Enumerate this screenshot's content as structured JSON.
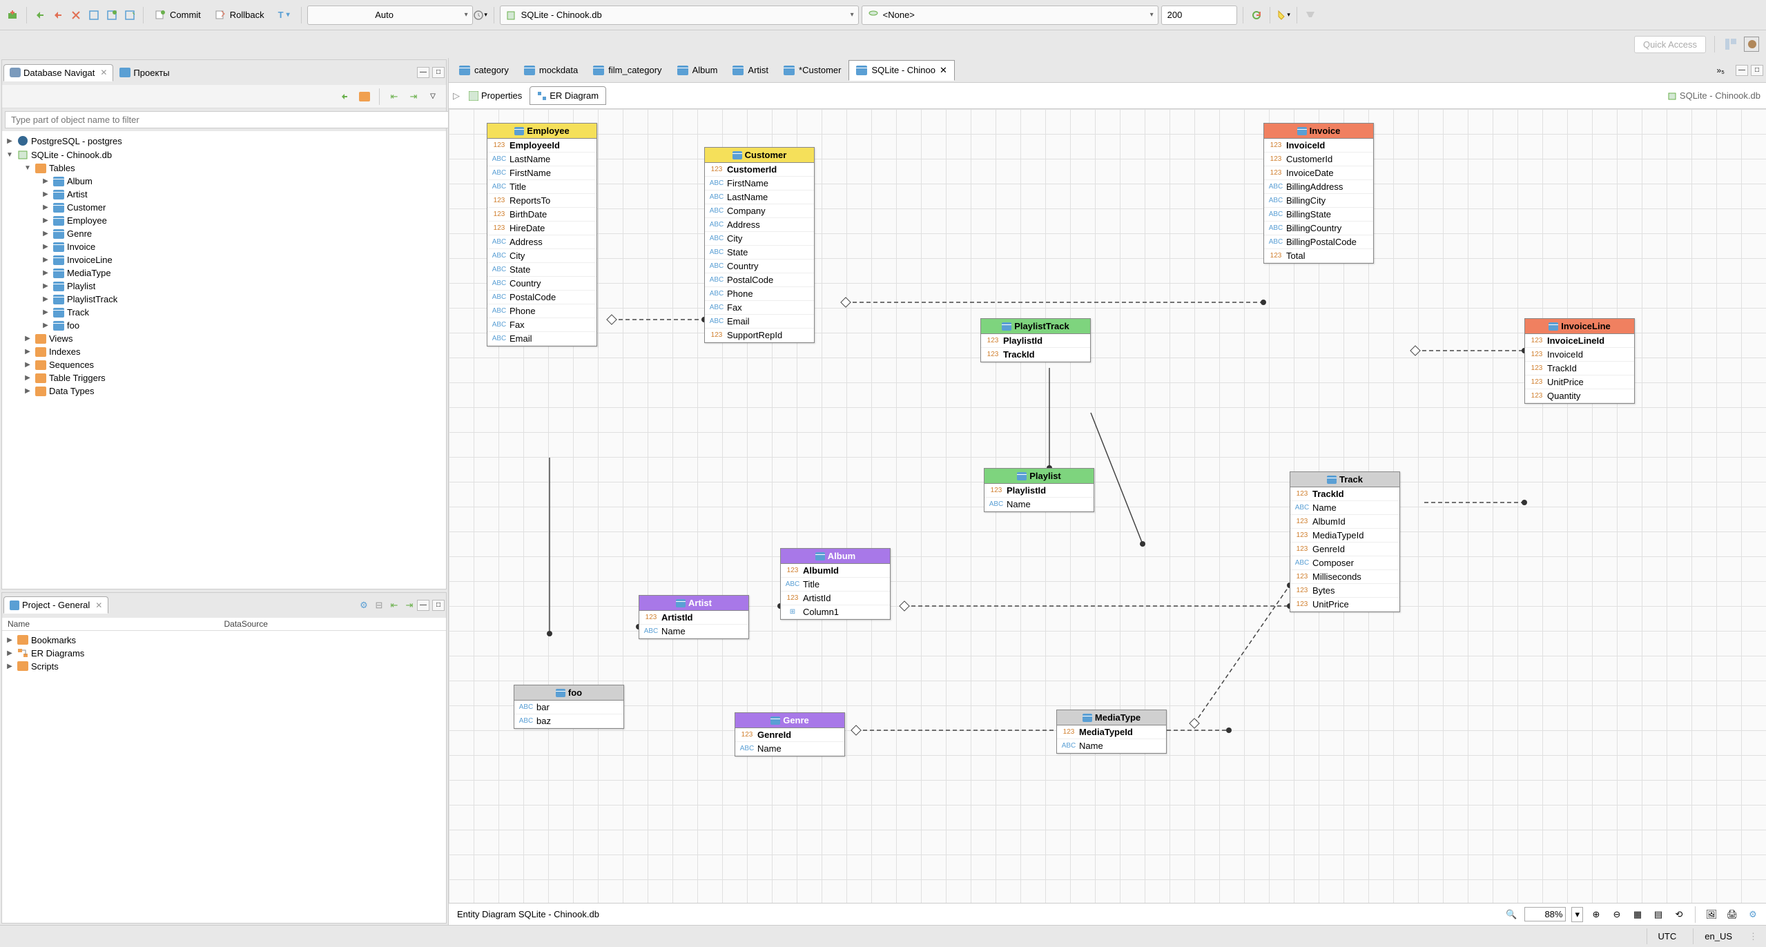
{
  "toolbar": {
    "commit": "Commit",
    "rollback": "Rollback",
    "tx_mode": "Auto",
    "datasource": "SQLite - Chinook.db",
    "schema": "<None>",
    "limit": "200",
    "quick_access": "Quick Access"
  },
  "nav_panel": {
    "title": "Database Navigat",
    "projects_tab": "Проекты",
    "filter_placeholder": "Type part of object name to filter",
    "connections": [
      {
        "name": "PostgreSQL - postgres",
        "expanded": false
      },
      {
        "name": "SQLite - Chinook.db",
        "expanded": true
      }
    ],
    "tables_label": "Tables",
    "tables": [
      "Album",
      "Artist",
      "Customer",
      "Employee",
      "Genre",
      "Invoice",
      "InvoiceLine",
      "MediaType",
      "Playlist",
      "PlaylistTrack",
      "Track",
      "foo"
    ],
    "folders": [
      "Views",
      "Indexes",
      "Sequences",
      "Table Triggers",
      "Data Types"
    ]
  },
  "project_panel": {
    "title": "Project - General",
    "col_name": "Name",
    "col_ds": "DataSource",
    "items": [
      "Bookmarks",
      "ER Diagrams",
      "Scripts"
    ]
  },
  "editor_tabs": [
    "category",
    "mockdata",
    "film_category",
    "Album",
    "Artist",
    "*Customer",
    "SQLite - Chinoo"
  ],
  "editor_active": 6,
  "editor_overflow": "»₅",
  "sub_tabs": {
    "properties": "Properties",
    "diagram": "ER Diagram"
  },
  "breadcrumb": "SQLite - Chinook.db",
  "er": {
    "employee": {
      "title": "Employee",
      "pk": "EmployeeId",
      "cols": [
        {
          "t": "abc",
          "n": "LastName"
        },
        {
          "t": "abc",
          "n": "FirstName"
        },
        {
          "t": "abc",
          "n": "Title"
        },
        {
          "t": "123",
          "n": "ReportsTo"
        },
        {
          "t": "123",
          "n": "BirthDate"
        },
        {
          "t": "123",
          "n": "HireDate"
        },
        {
          "t": "abc",
          "n": "Address"
        },
        {
          "t": "abc",
          "n": "City"
        },
        {
          "t": "abc",
          "n": "State"
        },
        {
          "t": "abc",
          "n": "Country"
        },
        {
          "t": "abc",
          "n": "PostalCode"
        },
        {
          "t": "abc",
          "n": "Phone"
        },
        {
          "t": "abc",
          "n": "Fax"
        },
        {
          "t": "abc",
          "n": "Email"
        }
      ]
    },
    "customer": {
      "title": "Customer",
      "pk": "CustomerId",
      "cols": [
        {
          "t": "abc",
          "n": "FirstName"
        },
        {
          "t": "abc",
          "n": "LastName"
        },
        {
          "t": "abc",
          "n": "Company"
        },
        {
          "t": "abc",
          "n": "Address"
        },
        {
          "t": "abc",
          "n": "City"
        },
        {
          "t": "abc",
          "n": "State"
        },
        {
          "t": "abc",
          "n": "Country"
        },
        {
          "t": "abc",
          "n": "PostalCode"
        },
        {
          "t": "abc",
          "n": "Phone"
        },
        {
          "t": "abc",
          "n": "Fax"
        },
        {
          "t": "abc",
          "n": "Email"
        },
        {
          "t": "123",
          "n": "SupportRepId"
        }
      ]
    },
    "invoice": {
      "title": "Invoice",
      "pk": "InvoiceId",
      "cols": [
        {
          "t": "123",
          "n": "CustomerId"
        },
        {
          "t": "123",
          "n": "InvoiceDate"
        },
        {
          "t": "abc",
          "n": "BillingAddress"
        },
        {
          "t": "abc",
          "n": "BillingCity"
        },
        {
          "t": "abc",
          "n": "BillingState"
        },
        {
          "t": "abc",
          "n": "BillingCountry"
        },
        {
          "t": "abc",
          "n": "BillingPostalCode"
        },
        {
          "t": "123",
          "n": "Total"
        }
      ]
    },
    "invoiceline": {
      "title": "InvoiceLine",
      "pk": "InvoiceLineId",
      "cols": [
        {
          "t": "123",
          "n": "InvoiceId"
        },
        {
          "t": "123",
          "n": "TrackId"
        },
        {
          "t": "123",
          "n": "UnitPrice"
        },
        {
          "t": "123",
          "n": "Quantity"
        }
      ]
    },
    "playlisttrack": {
      "title": "PlaylistTrack",
      "pk1": "PlaylistId",
      "pk2": "TrackId"
    },
    "playlist": {
      "title": "Playlist",
      "pk": "PlaylistId",
      "cols": [
        {
          "t": "abc",
          "n": "Name"
        }
      ]
    },
    "track": {
      "title": "Track",
      "pk": "TrackId",
      "cols": [
        {
          "t": "abc",
          "n": "Name"
        },
        {
          "t": "123",
          "n": "AlbumId"
        },
        {
          "t": "123",
          "n": "MediaTypeId"
        },
        {
          "t": "123",
          "n": "GenreId"
        },
        {
          "t": "abc",
          "n": "Composer"
        },
        {
          "t": "123",
          "n": "Milliseconds"
        },
        {
          "t": "123",
          "n": "Bytes"
        },
        {
          "t": "123",
          "n": "UnitPrice"
        }
      ]
    },
    "album": {
      "title": "Album",
      "pk": "AlbumId",
      "cols": [
        {
          "t": "abc",
          "n": "Title"
        },
        {
          "t": "123",
          "n": "ArtistId"
        },
        {
          "t": "grid",
          "n": "Column1"
        }
      ]
    },
    "artist": {
      "title": "Artist",
      "pk": "ArtistId",
      "cols": [
        {
          "t": "abc",
          "n": "Name"
        }
      ]
    },
    "genre": {
      "title": "Genre",
      "pk": "GenreId",
      "cols": [
        {
          "t": "abc",
          "n": "Name"
        }
      ]
    },
    "mediatype": {
      "title": "MediaType",
      "pk": "MediaTypeId",
      "cols": [
        {
          "t": "abc",
          "n": "Name"
        }
      ]
    },
    "foo": {
      "title": "foo",
      "cols": [
        {
          "t": "abc",
          "n": "bar"
        },
        {
          "t": "abc",
          "n": "baz"
        }
      ]
    }
  },
  "status": {
    "label": "Entity Diagram SQLite - Chinook.db",
    "zoom": "88%"
  },
  "bottom": {
    "tz": "UTC",
    "locale": "en_US"
  }
}
